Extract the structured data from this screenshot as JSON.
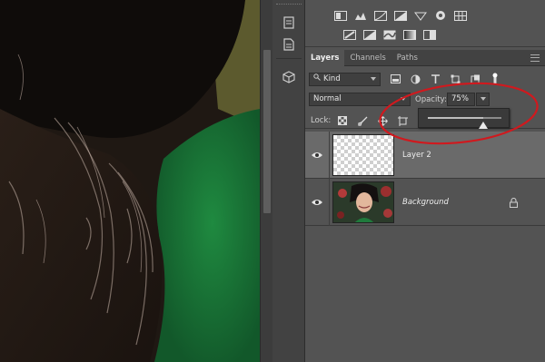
{
  "layers_panel": {
    "tabs": [
      {
        "label": "Layers",
        "active": true
      },
      {
        "label": "Channels",
        "active": false
      },
      {
        "label": "Paths",
        "active": false
      }
    ],
    "filter": {
      "value": "Kind"
    },
    "blend_mode": {
      "value": "Normal"
    },
    "opacity": {
      "label": "Opacity:",
      "value": "75%",
      "slider_fraction": 0.75
    },
    "lock": {
      "label": "Lock:"
    },
    "layers": [
      {
        "name": "Layer 2",
        "selected": true,
        "visible": true,
        "thumbnail": "transparent"
      },
      {
        "name": "Background",
        "selected": false,
        "visible": true,
        "locked": true,
        "thumbnail": "portrait"
      }
    ]
  },
  "adjustments": {
    "row1_icons": [
      "brightness-contrast-icon",
      "levels-icon",
      "curves-icon",
      "exposure-icon",
      "vibrance-icon",
      "hue-saturation-icon",
      "color-balance-icon"
    ],
    "row2_icons": [
      "invert-icon",
      "posterize-icon",
      "threshold-icon",
      "gradient-map-icon",
      "selective-color-icon"
    ]
  },
  "annotation": {
    "color": "#d0191e"
  },
  "colors": {
    "panel_bg": "#535353",
    "dark_bg": "#424242",
    "selected_layer": "#6a6a6a",
    "canvas_green": "#1c7a3a"
  }
}
